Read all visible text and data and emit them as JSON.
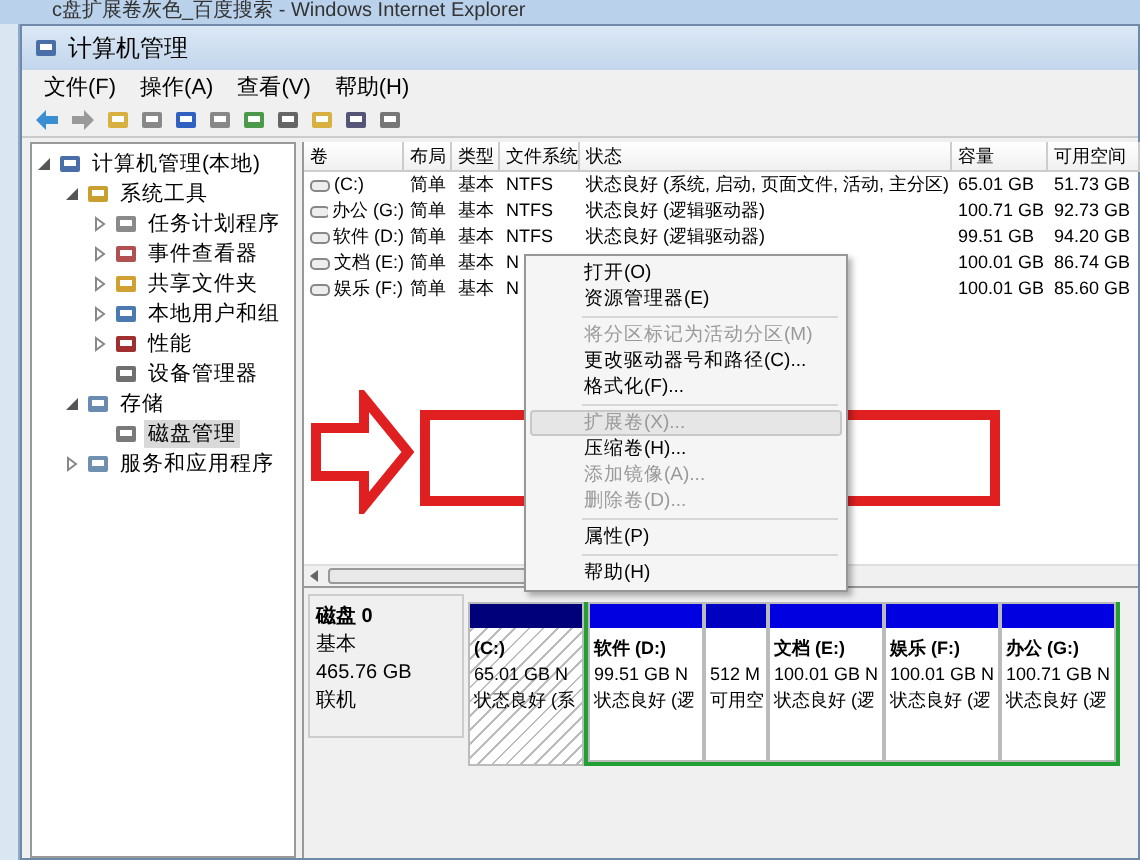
{
  "background_window": {
    "title": "c盘扩展卷灰色_百度搜索 - Windows Internet Explorer"
  },
  "window": {
    "title": "计算机管理"
  },
  "menu_bar": [
    "文件(F)",
    "操作(A)",
    "查看(V)",
    "帮助(H)"
  ],
  "tree": [
    {
      "label": "计算机管理(本地)",
      "expanded": true,
      "selected": false,
      "children": [
        {
          "label": "系统工具",
          "expanded": true,
          "selected": false,
          "children": [
            {
              "label": "任务计划程序",
              "expanded": false,
              "selected": false
            },
            {
              "label": "事件查看器",
              "expanded": false,
              "selected": false
            },
            {
              "label": "共享文件夹",
              "expanded": false,
              "selected": false
            },
            {
              "label": "本地用户和组",
              "expanded": false,
              "selected": false
            },
            {
              "label": "性能",
              "expanded": false,
              "selected": false
            },
            {
              "label": "设备管理器",
              "selected": false
            }
          ]
        },
        {
          "label": "存储",
          "expanded": true,
          "selected": false,
          "children": [
            {
              "label": "磁盘管理",
              "selected": true
            }
          ]
        },
        {
          "label": "服务和应用程序",
          "expanded": false,
          "selected": false
        }
      ]
    }
  ],
  "table": {
    "columns": [
      "卷",
      "布局",
      "类型",
      "文件系统",
      "状态",
      "容量",
      "可用空间"
    ],
    "rows": [
      {
        "cells": [
          "(C:)",
          "简单",
          "基本",
          "NTFS",
          "状态良好 (系统, 启动, 页面文件, 活动, 主分区)",
          "65.01 GB",
          "51.73 GB"
        ]
      },
      {
        "cells": [
          "办公 (G:)",
          "简单",
          "基本",
          "NTFS",
          "状态良好 (逻辑驱动器)",
          "100.71 GB",
          "92.73 GB"
        ]
      },
      {
        "cells": [
          "软件 (D:)",
          "简单",
          "基本",
          "NTFS",
          "状态良好 (逻辑驱动器)",
          "99.51 GB",
          "94.20 GB"
        ]
      },
      {
        "cells": [
          "文档 (E:)",
          "简单",
          "基本",
          "N",
          "",
          "100.01 GB",
          "86.74 GB"
        ]
      },
      {
        "cells": [
          "娱乐 (F:)",
          "简单",
          "基本",
          "N",
          "",
          "100.01 GB",
          "85.60 GB"
        ]
      }
    ]
  },
  "disk": {
    "name": "磁盘 0",
    "type": "基本",
    "size": "465.76 GB",
    "status": "联机",
    "partitions": [
      {
        "kind": "primary",
        "name": "(C:)",
        "size": "65.01 GB N",
        "status": "状态良好 (系",
        "selected": true
      },
      {
        "kind": "logical",
        "name": "软件  (D:)",
        "size": "99.51 GB N",
        "status": "状态良好 (逻",
        "selected": false
      },
      {
        "kind": "free",
        "size": "512 M",
        "status": "可用空",
        "selected": false
      },
      {
        "kind": "logical",
        "name": "文档  (E:)",
        "size": "100.01 GB N",
        "status": "状态良好 (逻",
        "selected": false
      },
      {
        "kind": "logical",
        "name": "娱乐  (F:)",
        "size": "100.01 GB N",
        "status": "状态良好 (逻",
        "selected": false
      },
      {
        "kind": "logical",
        "name": "办公  (G:)",
        "size": "100.71 GB N",
        "status": "状态良好 (逻",
        "selected": false
      }
    ]
  },
  "context_menu": {
    "groups": [
      [
        {
          "label": "打开(O)",
          "disabled": false,
          "highlighted": false
        },
        {
          "label": "资源管理器(E)",
          "disabled": false,
          "highlighted": false
        }
      ],
      [
        {
          "label": "将分区标记为活动分区(M)",
          "disabled": true,
          "highlighted": false
        },
        {
          "label": "更改驱动器号和路径(C)...",
          "disabled": false,
          "highlighted": false
        },
        {
          "label": "格式化(F)...",
          "disabled": false,
          "highlighted": false
        }
      ],
      [
        {
          "label": "扩展卷(X)...",
          "disabled": true,
          "highlighted": true
        },
        {
          "label": "压缩卷(H)...",
          "disabled": false,
          "highlighted": false
        },
        {
          "label": "添加镜像(A)...",
          "disabled": true,
          "highlighted": false
        },
        {
          "label": "删除卷(D)...",
          "disabled": true,
          "highlighted": false
        }
      ],
      [
        {
          "label": "属性(P)",
          "disabled": false,
          "highlighted": false
        }
      ],
      [
        {
          "label": "帮助(H)",
          "disabled": false,
          "highlighted": false
        }
      ]
    ]
  }
}
